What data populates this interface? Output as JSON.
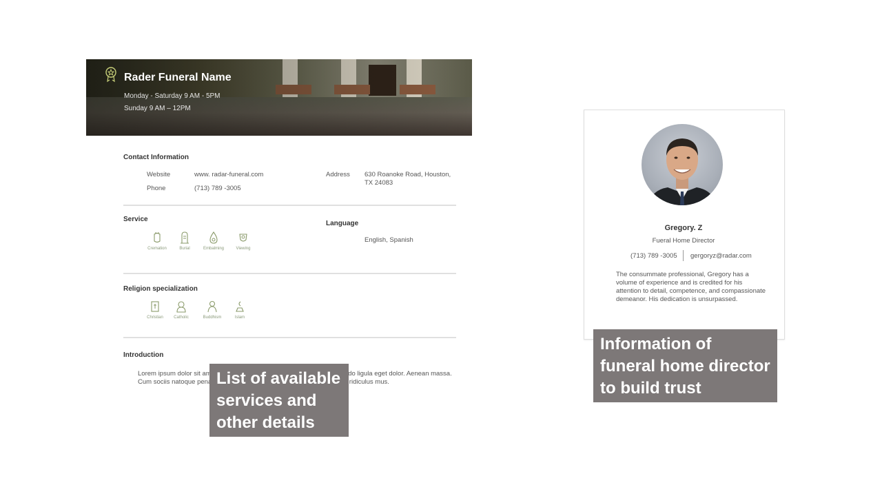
{
  "hero": {
    "title": "Rader Funeral Name",
    "hours_weekday": "Monday - Saturday 9 AM - 5PM",
    "hours_sunday": "Sunday 9 AM – 12PM"
  },
  "contact": {
    "title": "Contact Information",
    "website_label": "Website",
    "website_value": "www. radar-funeral.com",
    "phone_label": "Phone",
    "phone_value": "(713) 789 -3005",
    "address_label": "Address",
    "address_line1": "630 Roanoke Road, Houston,",
    "address_line2": "TX 24083"
  },
  "service": {
    "title": "Service",
    "items": [
      {
        "label": "Cremation",
        "icon": "cremation-icon"
      },
      {
        "label": "Burial",
        "icon": "burial-icon"
      },
      {
        "label": "Embalming",
        "icon": "embalming-icon"
      },
      {
        "label": "Viewing",
        "icon": "viewing-icon"
      }
    ]
  },
  "language": {
    "title": "Language",
    "value": "English, Spanish"
  },
  "religion": {
    "title": "Religion specialization",
    "items": [
      {
        "label": "Christian",
        "icon": "christian-icon"
      },
      {
        "label": "Catholic",
        "icon": "catholic-icon"
      },
      {
        "label": "Buddhism",
        "icon": "buddhism-icon"
      },
      {
        "label": "Islam",
        "icon": "islam-icon"
      }
    ]
  },
  "introduction": {
    "title": "Introduction",
    "text": "Lorem ipsum dolor sit amet, consectetuer adipiscing elit. Aenean commodo ligula eget dolor. Aenean massa. Cum sociis natoque penatibus et magnis dis parturient montes, nascetur ridiculus mus."
  },
  "director": {
    "name": "Gregory. Z",
    "role": "Fueral Home Director",
    "phone": "(713) 789 -3005",
    "email": "gergoryz@radar.com",
    "bio": "The consummate professional, Gregory has a volume of experience and is credited for his attention to detail, competence, and compassionate demeanor. His dedication is unsurpassed."
  },
  "callouts": {
    "left": "List of available services and other details",
    "right": "Information of funeral home director to build trust"
  },
  "colors": {
    "icon_green": "#8a9a6a",
    "callout_bg": "#7d7878"
  }
}
